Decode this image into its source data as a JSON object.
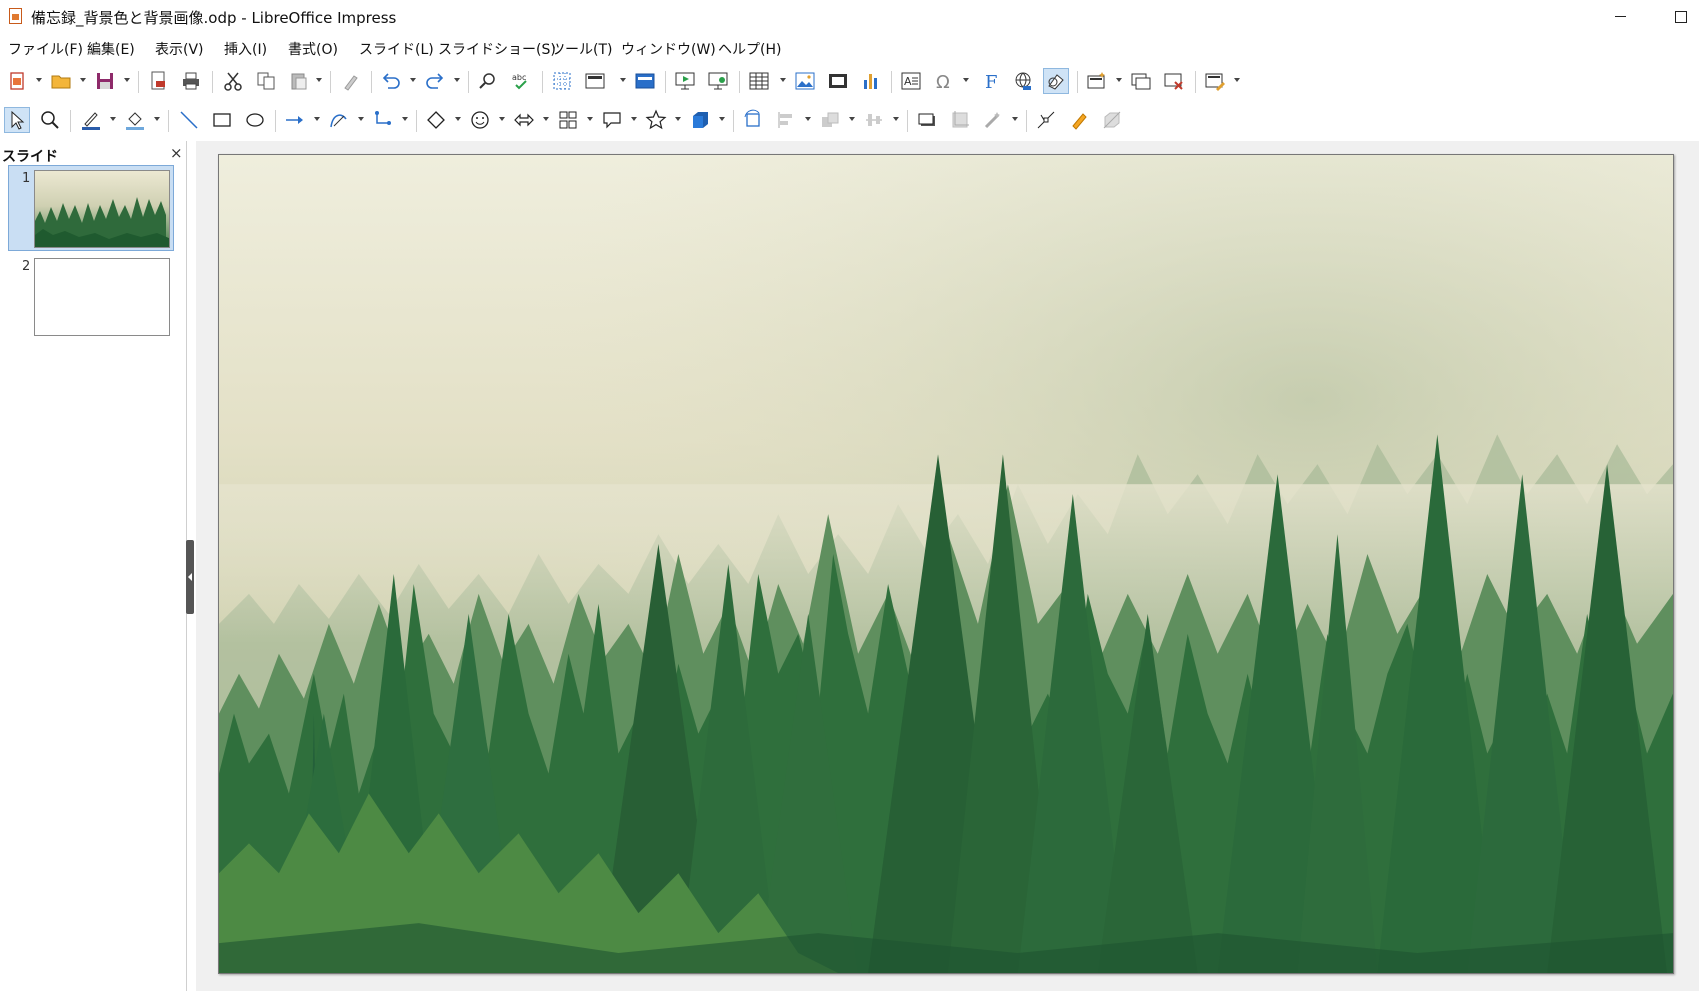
{
  "window": {
    "title": "備忘録_背景色と背景画像.odp - LibreOffice Impress"
  },
  "menu": [
    {
      "label": "ファイル(F)"
    },
    {
      "label": "編集(E)"
    },
    {
      "label": "表示(V)"
    },
    {
      "label": "挿入(I)"
    },
    {
      "label": "書式(O)"
    },
    {
      "label": "スライド(L)"
    },
    {
      "label": "スライドショー(S)"
    },
    {
      "label": "ツール(T)"
    },
    {
      "label": "ウィンドウ(W)"
    },
    {
      "label": "ヘルプ(H)"
    }
  ],
  "slide_pane": {
    "title": "スライド",
    "close_glyph": "×",
    "slides": [
      {
        "number": "1",
        "selected": true,
        "background": "forest-image"
      },
      {
        "number": "2",
        "selected": false,
        "background": "blank"
      }
    ]
  },
  "icons": {
    "standard_toolbar": [
      "new-document-icon",
      "open-icon",
      "save-icon",
      "export-pdf-icon",
      "print-icon",
      "cut-icon",
      "copy-icon",
      "paste-icon",
      "clone-formatting-icon",
      "undo-icon",
      "redo-icon",
      "find-replace-icon",
      "spelling-icon",
      "display-grid-icon",
      "slide-layout-icon",
      "master-slide-icon",
      "start-from-first-slide-icon",
      "start-from-current-slide-icon",
      "table-icon",
      "image-icon",
      "media-icon",
      "chart-icon",
      "text-box-icon",
      "special-character-icon",
      "fontwork-icon",
      "hyperlink-icon",
      "show-draw-functions-icon",
      "new-slide-icon",
      "duplicate-slide-icon",
      "delete-slide-icon",
      "display-views-icon"
    ],
    "drawing_toolbar": [
      "select-icon",
      "zoom-pan-icon",
      "line-color-icon",
      "fill-color-icon",
      "line-icon",
      "rectangle-icon",
      "ellipse-icon",
      "line-arrow-icon",
      "curve-icon",
      "connector-icon",
      "basic-shapes-icon",
      "symbol-shapes-icon",
      "block-arrows-icon",
      "flowchart-icon",
      "callout-icon",
      "stars-icon",
      "3d-objects-icon",
      "rotate-icon",
      "align-icon",
      "arrange-icon",
      "distribute-icon",
      "shadow-icon",
      "crop-icon",
      "filter-icon",
      "points-icon",
      "glue-points-icon",
      "toggle-extrusion-icon"
    ]
  },
  "colors": {
    "accent": "#2a6fc9",
    "selection": "#c9def3",
    "workspace_bg": "#f0f0f0"
  }
}
